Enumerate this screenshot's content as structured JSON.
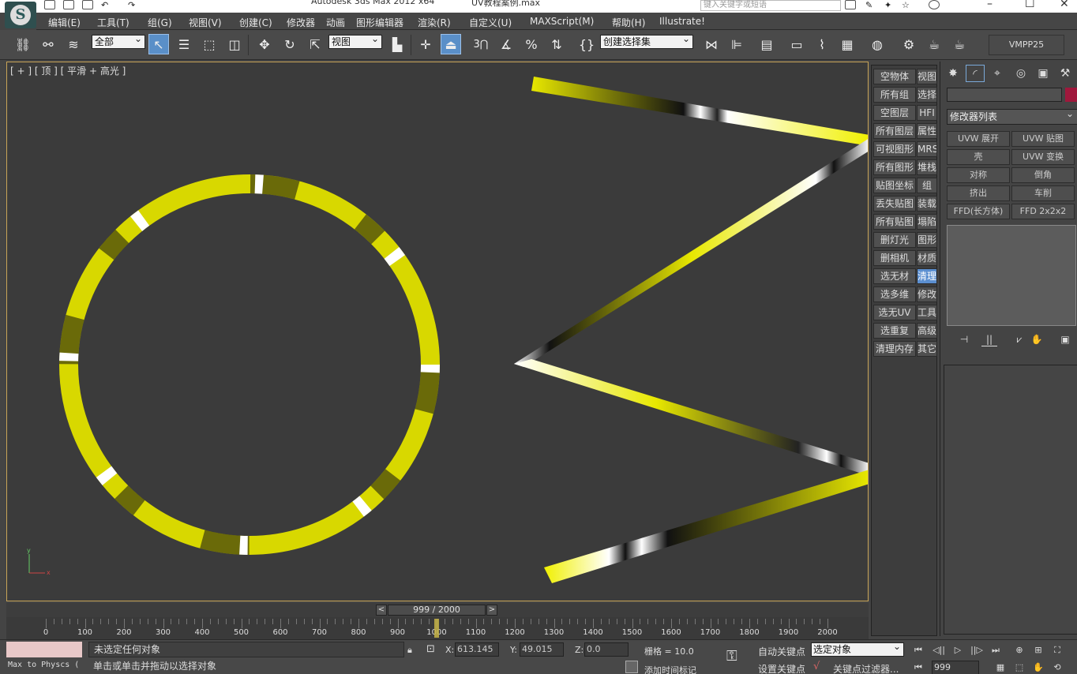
{
  "window": {
    "title": "Autodesk 3ds Max  2012 x64",
    "file": "UV教程案例.max",
    "search_placeholder": "键入关键字或短语"
  },
  "menu": [
    "编辑(E)",
    "工具(T)",
    "组(G)",
    "视图(V)",
    "创建(C)",
    "修改器",
    "动画",
    "图形编辑器",
    "渲染(R)",
    "自定义(U)",
    "MAXScript(M)",
    "帮助(H)",
    "Illustrate!"
  ],
  "toolbar": {
    "selection_filter": "全部",
    "ref_coord": "视图",
    "named_selection": "创建选择集",
    "vmpp_label": "VMPP25",
    "angle_snap_label": "3"
  },
  "viewport": {
    "label": "[ + ] [ 顶 ] [ 平滑 + 高光 ]",
    "axis_label": "y x z"
  },
  "script_panel": {
    "col1": [
      "空物体",
      "所有组",
      "空图层",
      "所有图层",
      "可视图形",
      "所有图形",
      "贴图坐标",
      "丢失贴图",
      "所有贴图",
      "删灯光",
      "删相机",
      "选无材",
      "选多维",
      "选无UV",
      "选重复",
      "清理内存"
    ],
    "col2": [
      "视图",
      "选择",
      "HFI",
      "属性",
      "MRS",
      "堆栈",
      "组",
      "装载",
      "塌陷",
      "图形",
      "材质",
      "清理",
      "修改",
      "工具",
      "高级",
      "其它"
    ],
    "highlighted": "清理"
  },
  "command_panel": {
    "modifier_list": "修改器列表",
    "buttons": [
      "UVW 展开",
      "UVW 贴图",
      "壳",
      "UVW 变换",
      "对称",
      "倒角",
      "挤出",
      "车削",
      "FFD(长方体)",
      "FFD 2x2x2"
    ],
    "object_color": "#a0183c"
  },
  "timeslider": {
    "frame": "999 / 2000",
    "prev": "<",
    "next": ">",
    "current_frame": 999,
    "total_frames": 2000
  },
  "track": {
    "labels": [
      "0",
      "100",
      "200",
      "300",
      "400",
      "500",
      "600",
      "700",
      "800",
      "900",
      "1000",
      "1100",
      "1200",
      "1300",
      "1400",
      "1500",
      "1600",
      "1700",
      "1800",
      "1900",
      "2000"
    ]
  },
  "status": {
    "maxphysx": "Max to Physcs (",
    "line1": "未选定任何对象",
    "line2": "单击或单击并拖动以选择对象",
    "x_label": "X:",
    "x_value": "613.145",
    "y_label": "Y:",
    "y_value": "49.015",
    "z_label": "Z:",
    "z_value": "0.0",
    "grid": "栅格 = 10.0",
    "add_time_tag": "添加时间标记",
    "auto_key": "自动关键点",
    "set_key": "设置关键点",
    "selected_object": "选定对象",
    "key_filter": "关键点过滤器...",
    "frame_value": "999"
  }
}
